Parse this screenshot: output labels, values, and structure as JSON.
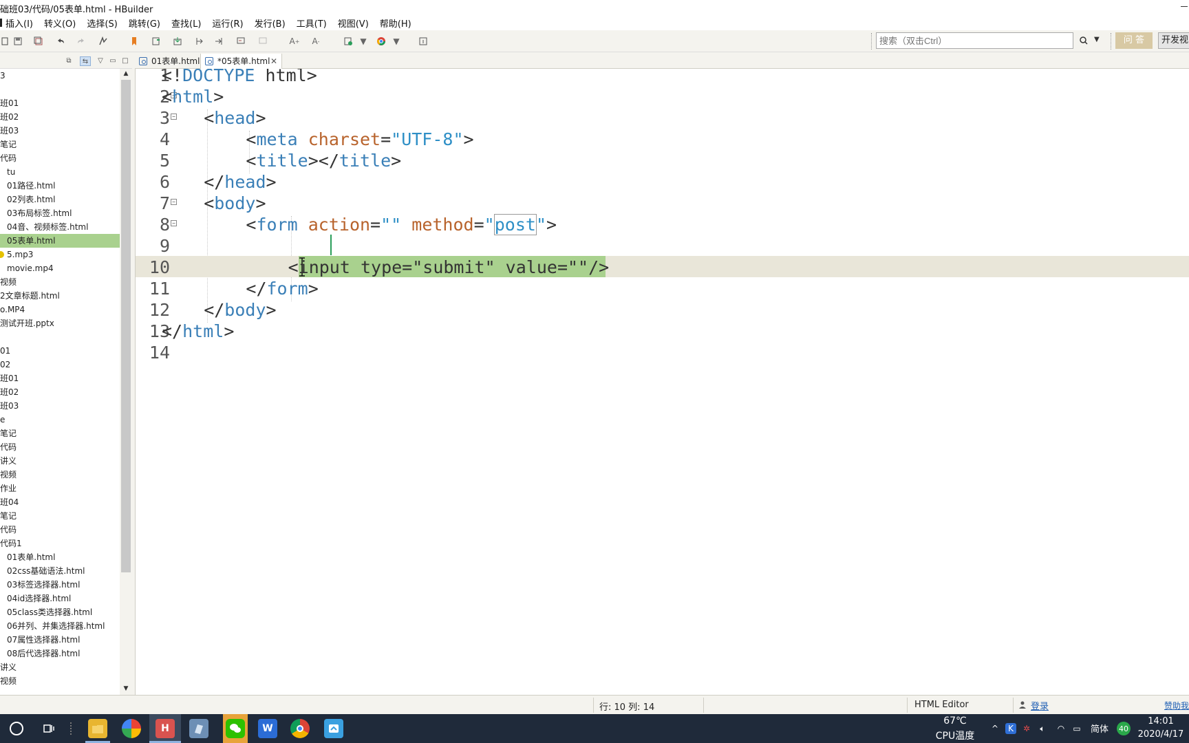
{
  "window": {
    "title": "础班03/代码/05表单.html  -  HBuilder"
  },
  "menu": {
    "items": [
      "插入(I)",
      "转义(O)",
      "选择(S)",
      "跳转(G)",
      "查找(L)",
      "运行(R)",
      "发行(B)",
      "工具(T)",
      "视图(V)",
      "帮助(H)"
    ]
  },
  "toolbar": {
    "search_placeholder": "搜索（双击Ctrl）",
    "answer_label": "问 答",
    "devview_label": "开发视"
  },
  "sidebar": {
    "items": [
      {
        "label": "3",
        "indent": 0
      },
      {
        "label": "",
        "indent": 0
      },
      {
        "label": "班01",
        "indent": 0
      },
      {
        "label": "班02",
        "indent": 0
      },
      {
        "label": "班03",
        "indent": 0
      },
      {
        "label": "笔记",
        "indent": 0
      },
      {
        "label": "代码",
        "indent": 0
      },
      {
        "label": "tu",
        "indent": 1
      },
      {
        "label": "01路径.html",
        "indent": 1
      },
      {
        "label": "02列表.html",
        "indent": 1
      },
      {
        "label": "03布局标签.html",
        "indent": 1
      },
      {
        "label": "04音、视频标签.html",
        "indent": 1
      },
      {
        "label": "05表单.html",
        "indent": 1,
        "selected": true
      },
      {
        "label": "5.mp3",
        "indent": 1,
        "mp3": true
      },
      {
        "label": "movie.mp4",
        "indent": 1
      },
      {
        "label": "视频",
        "indent": 0
      },
      {
        "label": "2文章标题.html",
        "indent": 0
      },
      {
        "label": "o.MP4",
        "indent": 0
      },
      {
        "label": "测试开班.pptx",
        "indent": 0
      },
      {
        "label": "",
        "indent": 0
      },
      {
        "label": "01",
        "indent": 0
      },
      {
        "label": "02",
        "indent": 0
      },
      {
        "label": "班01",
        "indent": 0
      },
      {
        "label": "班02",
        "indent": 0
      },
      {
        "label": "班03",
        "indent": 0
      },
      {
        "label": "e",
        "indent": 0
      },
      {
        "label": "笔记",
        "indent": 0
      },
      {
        "label": "代码",
        "indent": 0
      },
      {
        "label": "讲义",
        "indent": 0
      },
      {
        "label": "视频",
        "indent": 0
      },
      {
        "label": "作业",
        "indent": 0
      },
      {
        "label": "班04",
        "indent": 0
      },
      {
        "label": "笔记",
        "indent": 0
      },
      {
        "label": "代码",
        "indent": 0
      },
      {
        "label": "代码1",
        "indent": 0
      },
      {
        "label": "01表单.html",
        "indent": 1
      },
      {
        "label": "02css基础语法.html",
        "indent": 1
      },
      {
        "label": "03标签选择器.html",
        "indent": 1
      },
      {
        "label": "04id选择器.html",
        "indent": 1
      },
      {
        "label": "05class类选择器.html",
        "indent": 1
      },
      {
        "label": "06并列、并集选择器.html",
        "indent": 1
      },
      {
        "label": "07属性选择器.html",
        "indent": 1
      },
      {
        "label": "08后代选择器.html",
        "indent": 1
      },
      {
        "label": "讲义",
        "indent": 0
      },
      {
        "label": "视频",
        "indent": 0
      }
    ]
  },
  "tabs": [
    {
      "label": "01表单.html",
      "active": false
    },
    {
      "label": "*05表单.html",
      "active": true
    }
  ],
  "editor": {
    "current_line": 10,
    "lines": [
      {
        "n": "1",
        "fold": false,
        "indent": 0,
        "tokens": [
          [
            "punc",
            "<!"
          ],
          [
            "tag",
            "DOCTYPE"
          ],
          [
            "plain",
            " html"
          ],
          [
            "punc",
            ">"
          ]
        ]
      },
      {
        "n": "2",
        "fold": true,
        "indent": 0,
        "tokens": [
          [
            "punc",
            "<"
          ],
          [
            "tag",
            "html"
          ],
          [
            "punc",
            ">"
          ]
        ]
      },
      {
        "n": "3",
        "fold": true,
        "indent": 1,
        "tokens": [
          [
            "punc",
            "<"
          ],
          [
            "tag",
            "head"
          ],
          [
            "punc",
            ">"
          ]
        ]
      },
      {
        "n": "4",
        "fold": false,
        "indent": 2,
        "tokens": [
          [
            "punc",
            "<"
          ],
          [
            "tag",
            "meta"
          ],
          [
            "plain",
            " "
          ],
          [
            "attr",
            "charset"
          ],
          [
            "eq",
            "="
          ],
          [
            "str",
            "\"UTF-8\""
          ],
          [
            "punc",
            ">"
          ]
        ]
      },
      {
        "n": "5",
        "fold": false,
        "indent": 2,
        "tokens": [
          [
            "punc",
            "<"
          ],
          [
            "tag",
            "title"
          ],
          [
            "punc",
            "></"
          ],
          [
            "tag",
            "title"
          ],
          [
            "punc",
            ">"
          ]
        ]
      },
      {
        "n": "6",
        "fold": false,
        "indent": 1,
        "tokens": [
          [
            "punc",
            "</"
          ],
          [
            "tag",
            "head"
          ],
          [
            "punc",
            ">"
          ]
        ]
      },
      {
        "n": "7",
        "fold": true,
        "indent": 1,
        "tokens": [
          [
            "punc",
            "<"
          ],
          [
            "tag",
            "body"
          ],
          [
            "punc",
            ">"
          ]
        ]
      },
      {
        "n": "8",
        "fold": true,
        "indent": 2,
        "tokens": [
          [
            "punc",
            "<"
          ],
          [
            "tag",
            "form"
          ],
          [
            "plain",
            " "
          ],
          [
            "attr",
            "action"
          ],
          [
            "eq",
            "="
          ],
          [
            "str",
            "\"\""
          ],
          [
            "plain",
            " "
          ],
          [
            "attr",
            "method"
          ],
          [
            "eq",
            "="
          ],
          [
            "str",
            "\""
          ],
          [
            "strbox",
            "post"
          ],
          [
            "str",
            "\""
          ],
          [
            "punc",
            ">"
          ]
        ]
      },
      {
        "n": "9",
        "fold": false,
        "indent": 3,
        "tokens": []
      },
      {
        "n": "10",
        "fold": false,
        "indent": 3,
        "tokens": [
          [
            "punc",
            "<"
          ],
          [
            "plain",
            "input type=\"submit\" value=\"\"/>"
          ]
        ]
      },
      {
        "n": "11",
        "fold": false,
        "indent": 2,
        "tokens": [
          [
            "punc",
            "</"
          ],
          [
            "tag",
            "form"
          ],
          [
            "punc",
            ">"
          ]
        ]
      },
      {
        "n": "12",
        "fold": false,
        "indent": 1,
        "tokens": [
          [
            "punc",
            "</"
          ],
          [
            "tag",
            "body"
          ],
          [
            "punc",
            ">"
          ]
        ]
      },
      {
        "n": "13",
        "fold": false,
        "indent": 0,
        "tokens": [
          [
            "punc",
            "</"
          ],
          [
            "tag",
            "html"
          ],
          [
            "punc",
            ">"
          ]
        ]
      },
      {
        "n": "14",
        "fold": false,
        "indent": 0,
        "tokens": []
      }
    ]
  },
  "status": {
    "position": "行: 10 列: 14",
    "editor_type": "HTML Editor",
    "login": "登录",
    "help": "赞助我"
  },
  "taskbar": {
    "temp": "67℃",
    "temp_label": "CPU温度",
    "ime": "简体",
    "badge": "40",
    "time": "14:01",
    "date": "2020/4/17"
  },
  "colors": {
    "tag": "#3a7fb7",
    "attr": "#b8632c",
    "string": "#2e8fc6",
    "selection": "#a9d18e",
    "current_line": "#e9e6d9"
  }
}
